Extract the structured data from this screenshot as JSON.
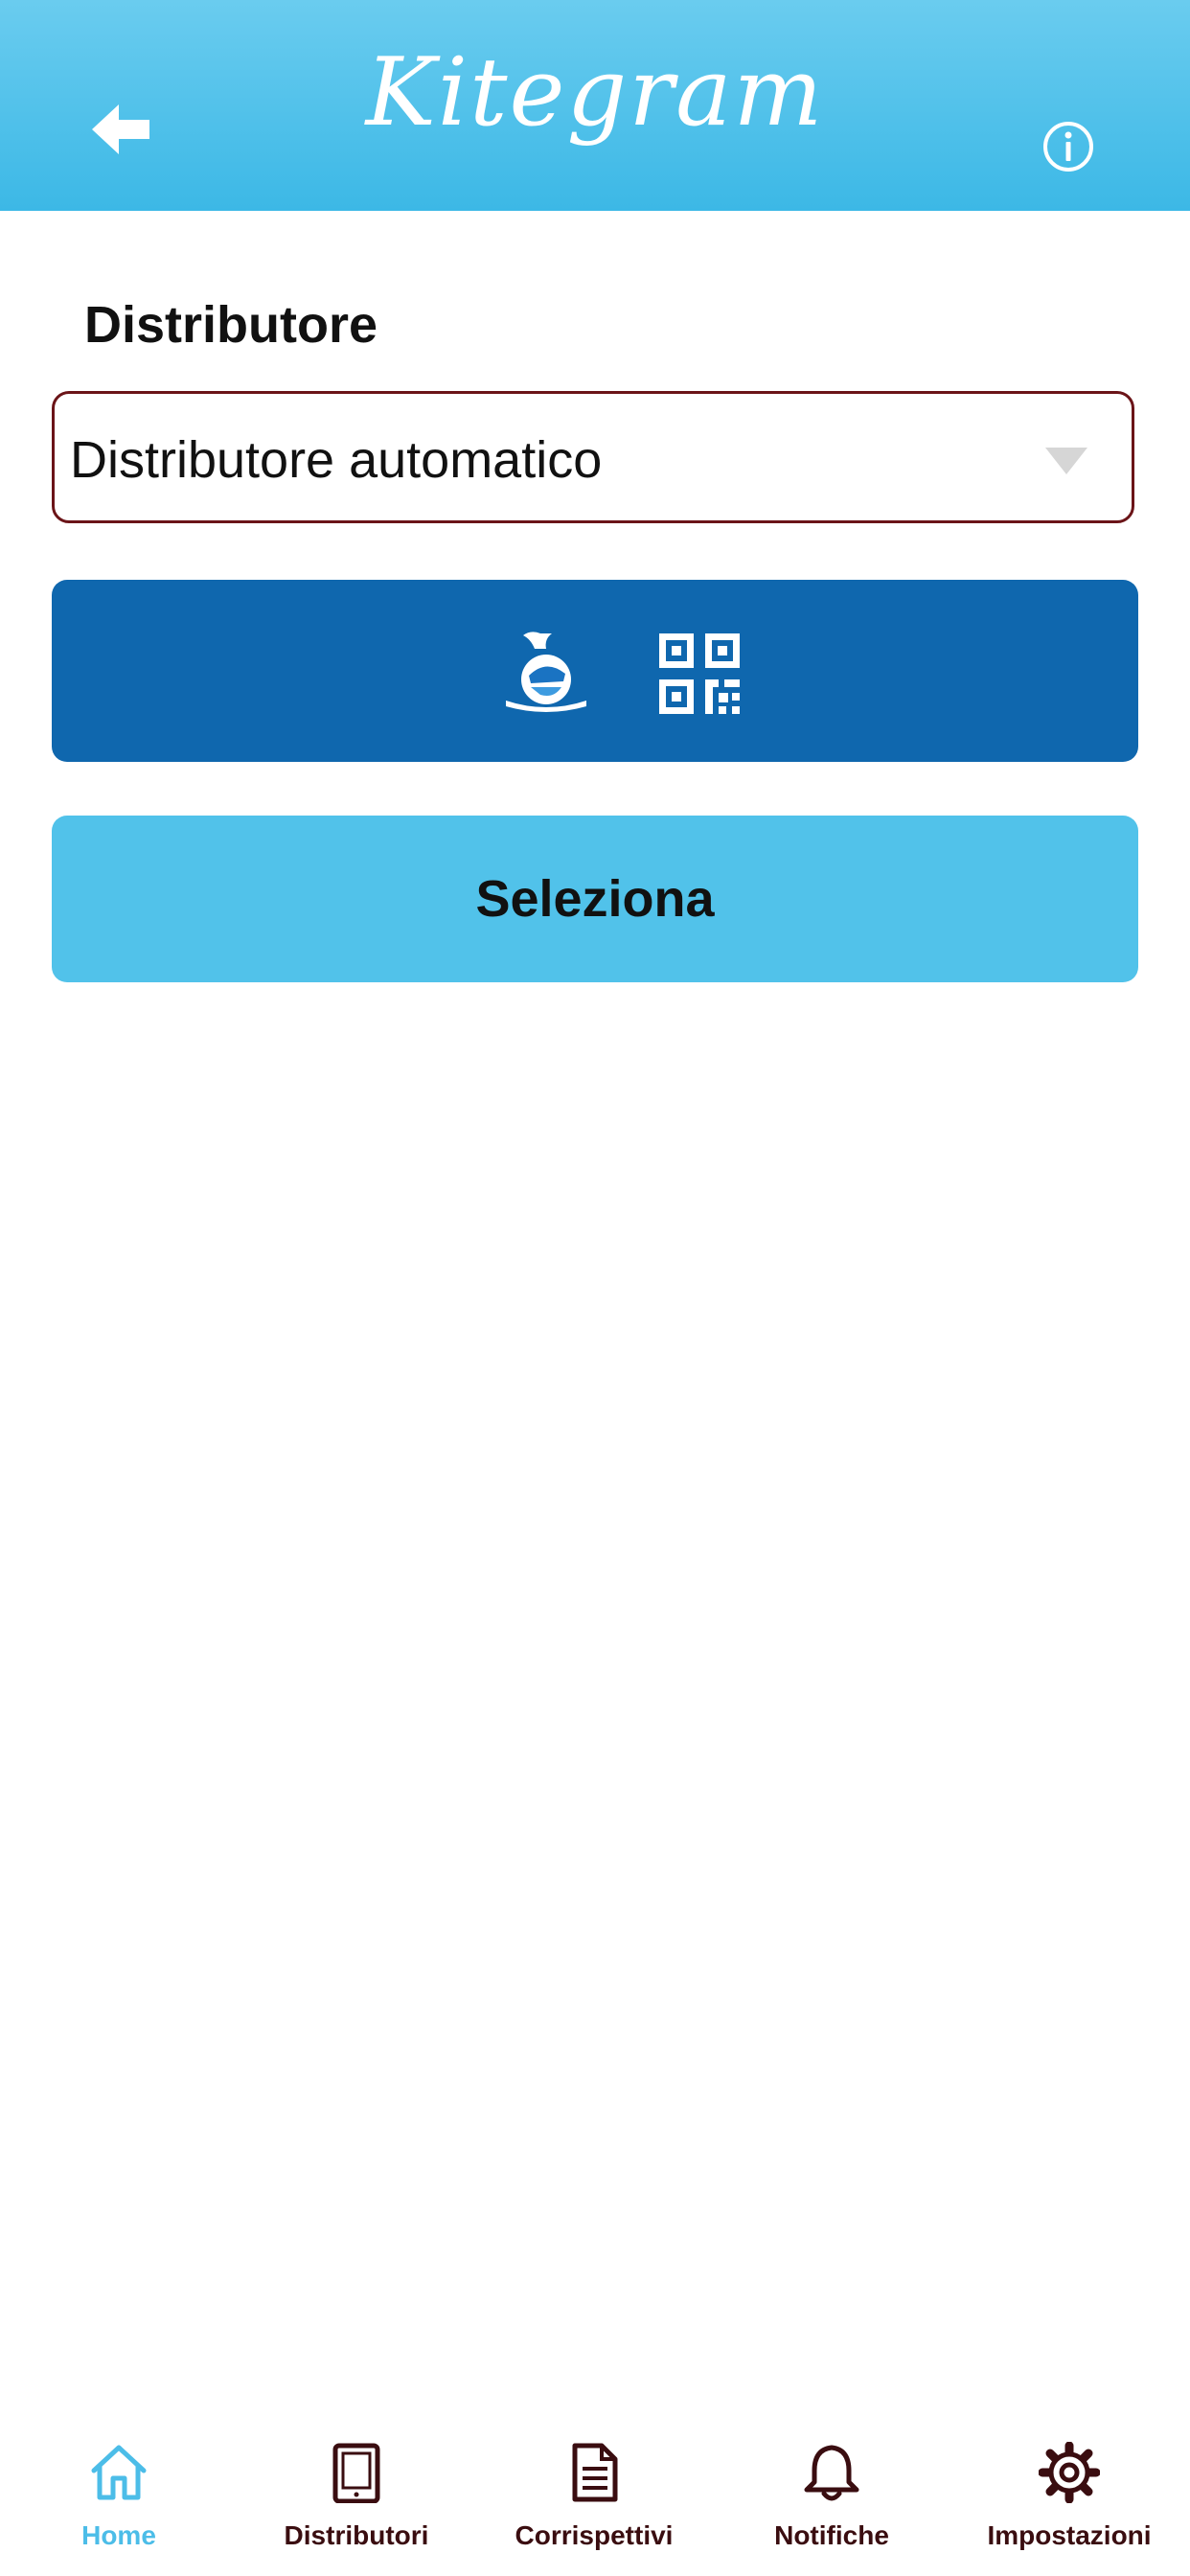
{
  "header": {
    "title": "Kitegram",
    "back_icon": "arrow-left-icon",
    "info_icon": "info-icon"
  },
  "form": {
    "label": "Distributore",
    "select": {
      "value": "Distributore automatico",
      "caret_icon": "chevron-down-icon"
    },
    "scan_button": {
      "icons": [
        "agency-logo-icon",
        "qr-code-icon"
      ]
    },
    "submit_label": "Seleziona"
  },
  "tabbar": {
    "items": [
      {
        "label": "Home",
        "icon": "home-icon",
        "active": true
      },
      {
        "label": "Distributori",
        "icon": "tablet-icon",
        "active": false
      },
      {
        "label": "Corrispettivi",
        "icon": "document-icon",
        "active": false
      },
      {
        "label": "Notifiche",
        "icon": "bell-icon",
        "active": false
      },
      {
        "label": "Impostazioni",
        "icon": "gear-icon",
        "active": false
      }
    ]
  },
  "colors": {
    "header": "#3cb8e6",
    "scan_button": "#0f67ae",
    "submit_button": "#51c2ea",
    "tab_active": "#4cbde8",
    "tab_inactive": "#3a0d10",
    "select_border": "#6b1418"
  }
}
